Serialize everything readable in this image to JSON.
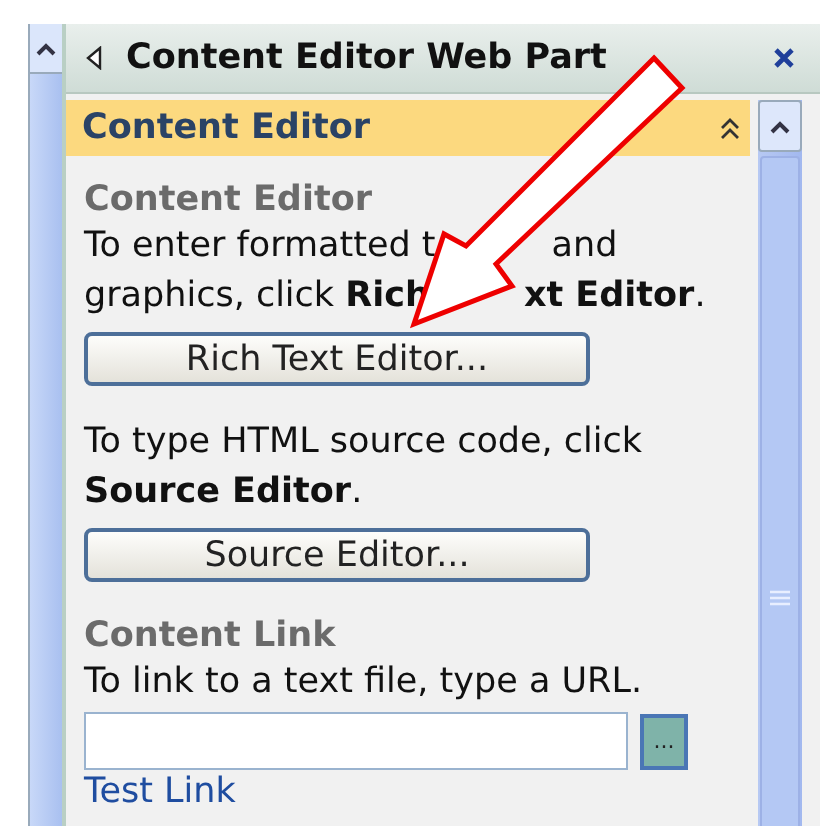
{
  "pane": {
    "title": "Content Editor Web Part"
  },
  "section": {
    "title": "Content Editor",
    "expanded": true
  },
  "content_editor": {
    "heading": "Content Editor",
    "intro_lines": [
      {
        "parts": [
          "To enter formatted t",
          "and"
        ]
      },
      {
        "parts": [
          "graphics, click **Rich**",
          "**xt Editor**."
        ]
      }
    ],
    "rich_button": "Rich Text Editor...",
    "source_text": "To type HTML source code, click **Source Editor**.",
    "source_button": "Source Editor..."
  },
  "content_link": {
    "heading": "Content Link",
    "text": "To link to a text file, type a URL.",
    "browse_button": "...",
    "test_link": "Test Link"
  }
}
